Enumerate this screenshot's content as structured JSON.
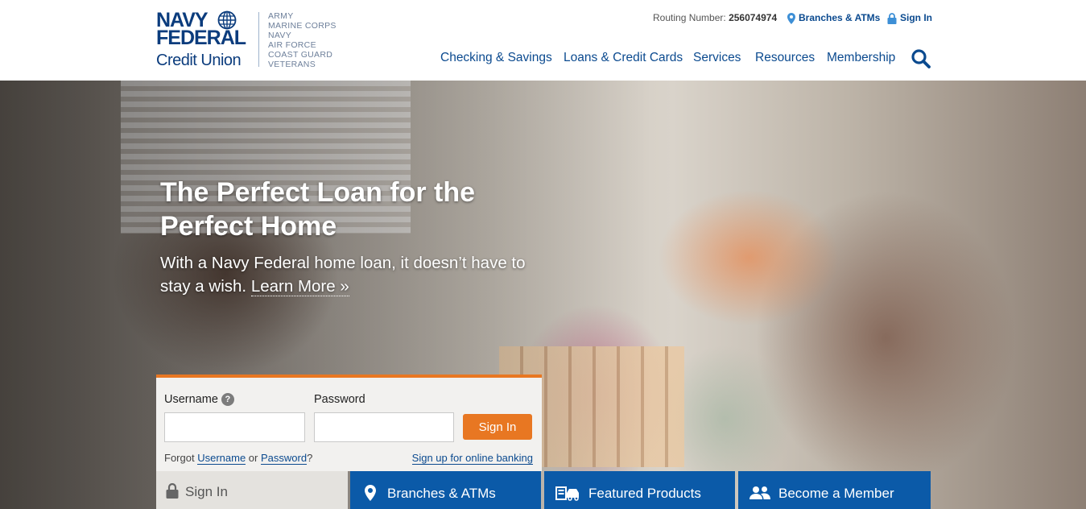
{
  "logo": {
    "line1": "NAVY",
    "line2": "FEDERAL",
    "line3": "Credit Union"
  },
  "branches": [
    "ARMY",
    "MARINE CORPS",
    "NAVY",
    "AIR FORCE",
    "COAST GUARD",
    "VETERANS"
  ],
  "utility": {
    "routing_label": "Routing Number:",
    "routing_number": "256074974",
    "branches_link": "Branches & ATMs",
    "signin_link": "Sign In"
  },
  "nav": {
    "items": [
      "Checking & Savings",
      "Loans & Credit Cards",
      "Services",
      "Resources",
      "Membership"
    ]
  },
  "hero": {
    "title": "The Perfect Loan for the Perfect Home",
    "subtitle": "With a Navy Federal home loan, it doesn’t have to stay a wish.",
    "learn_more": "Learn More »"
  },
  "login": {
    "username_label": "Username",
    "password_label": "Password",
    "signin_button": "Sign In",
    "forgot_prefix": "Forgot",
    "forgot_username": "Username",
    "forgot_or": "or",
    "forgot_password": "Password",
    "forgot_suffix": "?",
    "signup_link": "Sign up for online banking",
    "username_value": "",
    "password_value": ""
  },
  "tabs": {
    "signin": "Sign In",
    "branches": "Branches & ATMs",
    "featured": "Featured Products",
    "member": "Become a Member"
  },
  "colors": {
    "brand_navy": "#0b3c7d",
    "link_blue": "#0b4a8f",
    "accent_orange": "#e87722",
    "tab_blue": "#0b5aa8"
  }
}
